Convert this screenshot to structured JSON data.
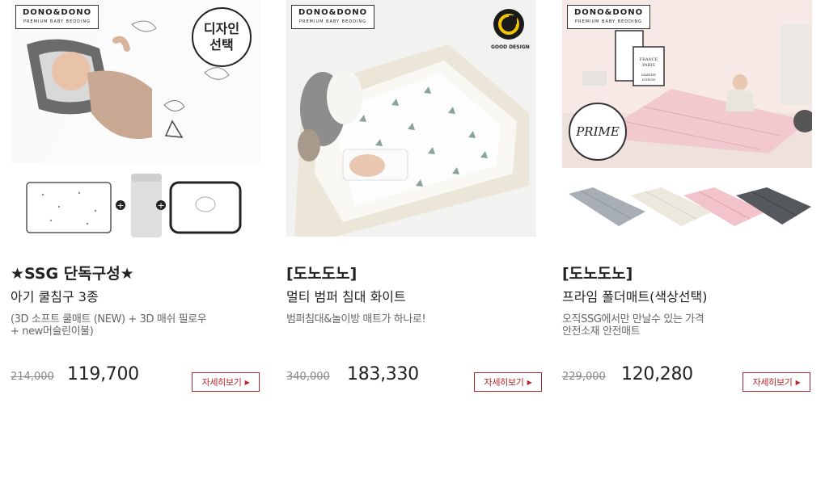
{
  "products": [
    {
      "brand": "DONO&DONO",
      "brand_tagline": "PREMIUM BABY BEDDING",
      "badge": "디자인\n선택",
      "title_line1": "★SSG 단독구성★",
      "title_line2": "아기 쿨침구 3종",
      "description": "(3D 소프트 쿨매트 (NEW) + 3D 매쉬 필로우\n+ new머슬린이불)",
      "original_price": "214,000",
      "price": "119,700",
      "more_label": "자세히보기"
    },
    {
      "brand": "DONO&DONO",
      "brand_tagline": "PREMIUM BABY BEDDING",
      "badge": "GOOD DESIGN",
      "title_line1": "[도노도노]",
      "title_line2": "멀티 범퍼 침대 화이트",
      "description": "범퍼침대&놀이방 매트가 하나로!",
      "original_price": "340,000",
      "price": "183,330",
      "more_label": "자세히보기"
    },
    {
      "brand": "DONO&DONO",
      "brand_tagline": "PREMIUM BABY BEDDING",
      "badge": "PRIME",
      "title_line1": "[도노도노]",
      "title_line2": "프라임 폴더매트(색상선택)",
      "description": "오직SSG에서만 만날수 있는 가격\n안전소재 안전매트",
      "original_price": "229,000",
      "price": "120,280",
      "more_label": "자세히보기"
    }
  ],
  "colors": {
    "accent": "#b3262e",
    "mat_pink": "#f3d4d8",
    "mat_grey": "#a8aeb6",
    "mat_dark": "#55585c"
  },
  "icons": [
    "plus-icon",
    "arrow-right-icon",
    "good-design-icon",
    "prime-icon"
  ]
}
